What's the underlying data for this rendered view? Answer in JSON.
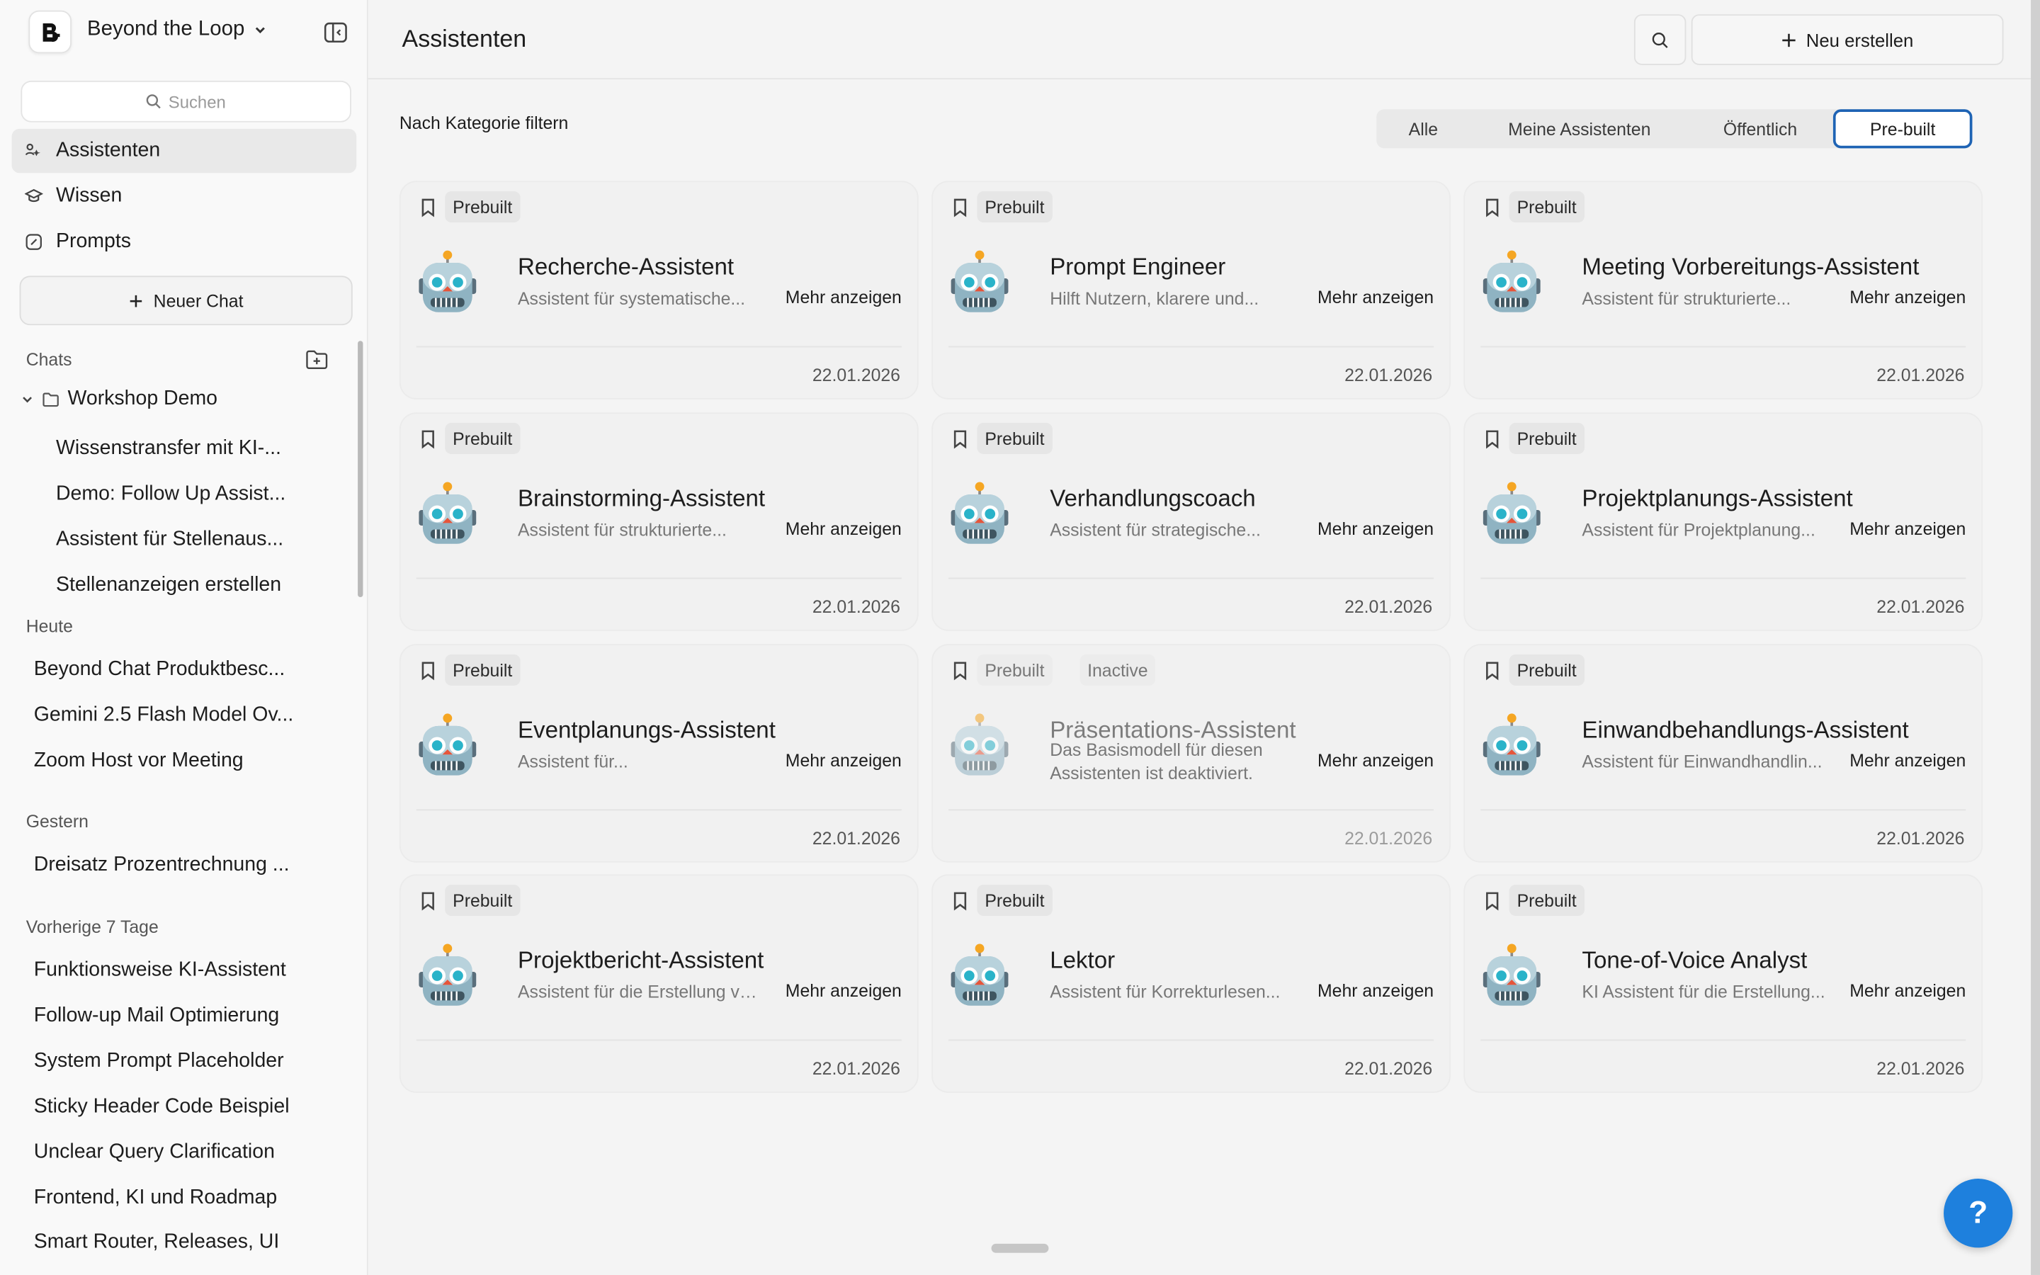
{
  "sidebar": {
    "workspace_name": "Beyond the Loop",
    "search_placeholder": "Suchen",
    "nav": [
      {
        "label": "Assistenten",
        "icon": "assistants-icon"
      },
      {
        "label": "Wissen",
        "icon": "knowledge-icon"
      },
      {
        "label": "Prompts",
        "icon": "prompts-icon"
      }
    ],
    "new_chat_label": "Neuer Chat",
    "chats_label": "Chats",
    "folder": {
      "name": "Workshop Demo",
      "items": [
        "Wissenstransfer mit KI-...",
        "Demo: Follow Up Assist...",
        "Assistent für Stellenaus...",
        "Stellenanzeigen erstellen"
      ]
    },
    "groups": [
      {
        "label": "Heute",
        "items": [
          "Beyond Chat Produktbesc...",
          "Gemini 2.5 Flash Model Ov...",
          "Zoom Host vor Meeting"
        ]
      },
      {
        "label": "Gestern",
        "items": [
          "Dreisatz Prozentrechnung ..."
        ]
      },
      {
        "label": "Vorherige 7 Tage",
        "items": [
          "Funktionsweise KI-Assistent",
          "Follow-up Mail Optimierung",
          "System Prompt Placeholder",
          "Sticky Header Code Beispiel",
          "Unclear Query Clarification",
          "Frontend, KI und Roadmap",
          "Smart Router, Releases, UI"
        ]
      }
    ]
  },
  "header": {
    "title": "Assistenten",
    "create_label": "Neu erstellen"
  },
  "filter": {
    "label": "Nach Kategorie filtern",
    "tabs": [
      "Alle",
      "Meine Assistenten",
      "Öffentlich",
      "Pre-built"
    ],
    "active": "Pre-built"
  },
  "more_label": "Mehr anzeigen",
  "cards": [
    {
      "title": "Recherche-Assistent",
      "desc": "Assistent für systematische...",
      "date": "22.01.2026",
      "badges": [
        "Prebuilt"
      ]
    },
    {
      "title": "Prompt Engineer",
      "desc": "Hilft Nutzern, klarere und...",
      "date": "22.01.2026",
      "badges": [
        "Prebuilt"
      ]
    },
    {
      "title": "Meeting Vorbereitungs-Assistent",
      "desc": "Assistent für strukturierte...",
      "date": "22.01.2026",
      "badges": [
        "Prebuilt"
      ]
    },
    {
      "title": "Brainstorming-Assistent",
      "desc": "Assistent für strukturierte...",
      "date": "22.01.2026",
      "badges": [
        "Prebuilt"
      ]
    },
    {
      "title": "Verhandlungscoach",
      "desc": "Assistent für strategische...",
      "date": "22.01.2026",
      "badges": [
        "Prebuilt"
      ]
    },
    {
      "title": "Projektplanungs-Assistent",
      "desc": "Assistent für Projektplanung...",
      "date": "22.01.2026",
      "badges": [
        "Prebuilt"
      ]
    },
    {
      "title": "Eventplanungs-Assistent",
      "desc": "Assistent für...",
      "date": "22.01.2026",
      "badges": [
        "Prebuilt"
      ]
    },
    {
      "title": "Präsentations-Assistent",
      "desc": "Das Basismodell für diesen Assistenten ist deaktiviert.",
      "date": "22.01.2026",
      "badges": [
        "Prebuilt",
        "Inactive"
      ],
      "inactive": true
    },
    {
      "title": "Einwandbehandlungs-Assistent",
      "desc": "Assistent für Einwandhandlin...",
      "date": "22.01.2026",
      "badges": [
        "Prebuilt"
      ]
    },
    {
      "title": "Projektbericht-Assistent",
      "desc": "Assistent für die Erstellung vo...",
      "date": "22.01.2026",
      "badges": [
        "Prebuilt"
      ]
    },
    {
      "title": "Lektor",
      "desc": "Assistent für Korrekturlesen...",
      "date": "22.01.2026",
      "badges": [
        "Prebuilt"
      ]
    },
    {
      "title": "Tone-of-Voice Analyst",
      "desc": "KI Assistent für die Erstellung...",
      "date": "22.01.2026",
      "badges": [
        "Prebuilt"
      ]
    }
  ],
  "help_label": "?",
  "colors": {
    "accent": "#1e63b4",
    "help": "#1e80dd"
  }
}
